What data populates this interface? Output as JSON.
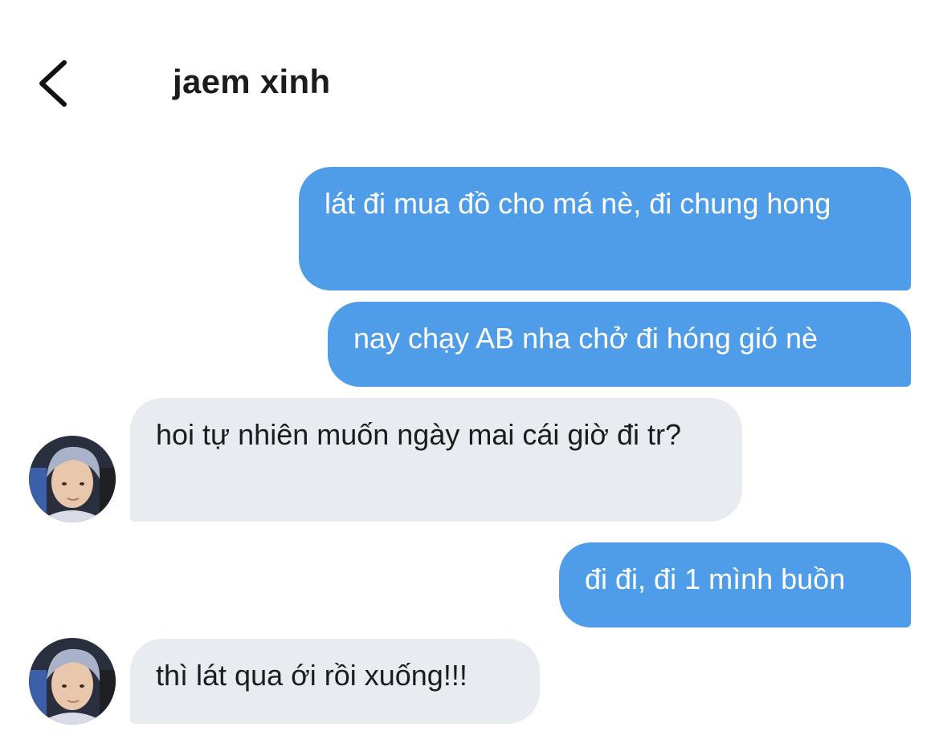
{
  "header": {
    "back_icon": "chevron-left-icon",
    "title": "jaem xinh"
  },
  "messages": [
    {
      "direction": "sent",
      "text": "lát đi mua đồ cho má nè, đi chung hong"
    },
    {
      "direction": "sent",
      "text": "nay chạy AB nha chở đi hóng gió nè"
    },
    {
      "direction": "received",
      "text": "hoi tự nhiên muốn ngày mai cái giờ đi tr?"
    },
    {
      "direction": "sent",
      "text": "đi đi, đi 1 mình buồn"
    },
    {
      "direction": "received",
      "text": "thì lát qua ới rồi xuống!!!"
    }
  ],
  "colors": {
    "sent_bubble": "#4f9de8",
    "received_bubble": "#e8ebef",
    "background": "#ffffff",
    "text_dark": "#1c1c1e"
  }
}
